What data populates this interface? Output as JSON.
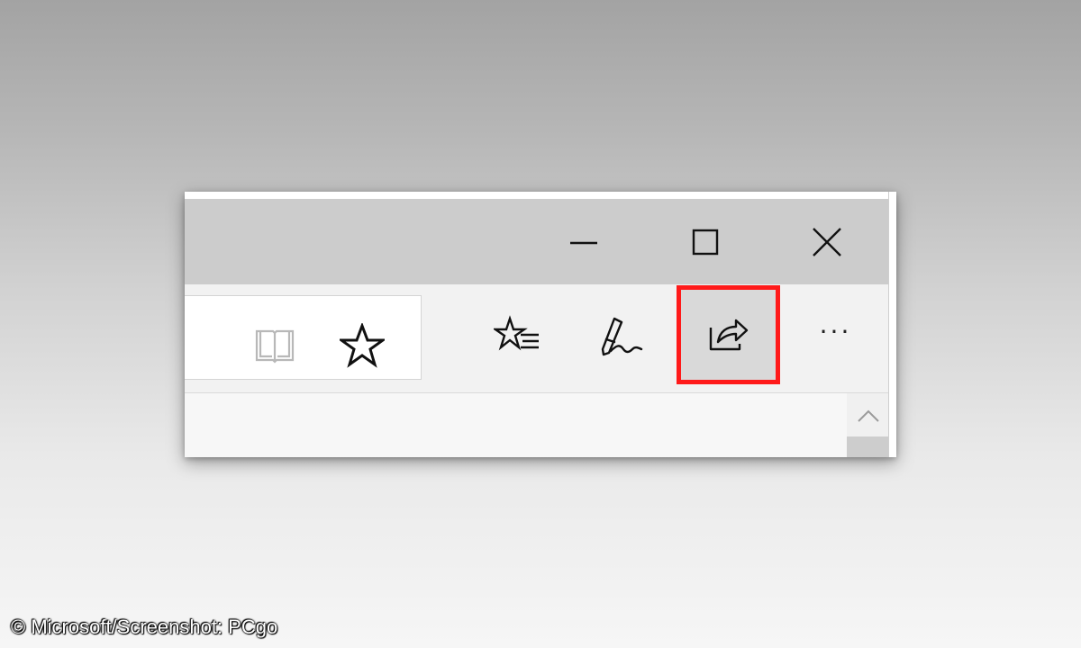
{
  "window": {
    "caption_buttons": {
      "minimize": {
        "icon": "minimize-icon"
      },
      "maximize": {
        "icon": "maximize-icon"
      },
      "close": {
        "icon": "close-icon"
      }
    }
  },
  "toolbar": {
    "address_bar": {
      "reading_view": {
        "icon": "reading-view-book-icon",
        "state": "disabled"
      },
      "favorite": {
        "icon": "star-icon"
      }
    },
    "hub": {
      "icon": "hub-star-list-icon"
    },
    "web_note": {
      "icon": "pen-note-icon"
    },
    "share": {
      "icon": "share-icon",
      "highlighted": true,
      "highlight_color": "#ff1a1a"
    },
    "more": {
      "icon": "more-icon",
      "label": "···"
    }
  },
  "scrollbar": {
    "up_icon": "chevron-up-icon"
  },
  "caption": "© Microsoft/Screenshot: PCgo",
  "colors": {
    "titlebar": "#cccccc",
    "toolbar": "#f2f2f2",
    "highlight_border": "#ff1a1a",
    "share_button_bg": "#d9d9d9"
  }
}
